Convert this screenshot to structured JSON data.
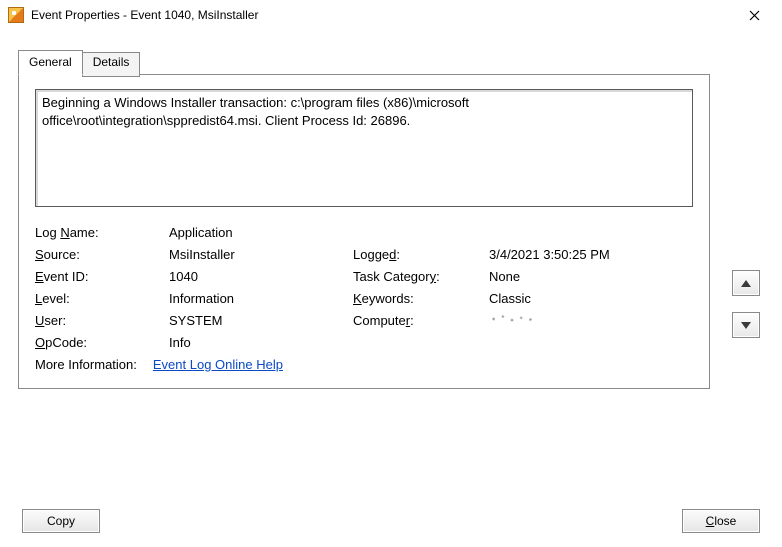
{
  "window": {
    "title": "Event Properties - Event 1040, MsiInstaller"
  },
  "tabs": {
    "general": "General",
    "details": "Details"
  },
  "message": "Beginning a Windows Installer transaction: c:\\program files (x86)\\microsoft office\\root\\integration\\sppredist64.msi. Client Process Id: 26896.",
  "labels": {
    "log_name": "Log Name:",
    "source": "Source:",
    "event_id": "Event ID:",
    "level": "Level:",
    "user": "User:",
    "opcode": "OpCode:",
    "more_info": "More Information:",
    "logged": "Logged:",
    "task_category": "Task Category:",
    "keywords": "Keywords:",
    "computer": "Computer:"
  },
  "values": {
    "log_name": "Application",
    "source": "MsiInstaller",
    "event_id": "1040",
    "level": "Information",
    "user": "SYSTEM",
    "opcode": "Info",
    "logged": "3/4/2021 3:50:25 PM",
    "task_category": "None",
    "keywords": "Classic",
    "computer": "[redacted]"
  },
  "links": {
    "online_help": "Event Log Online Help"
  },
  "buttons": {
    "copy": "Copy",
    "close": "Close"
  }
}
